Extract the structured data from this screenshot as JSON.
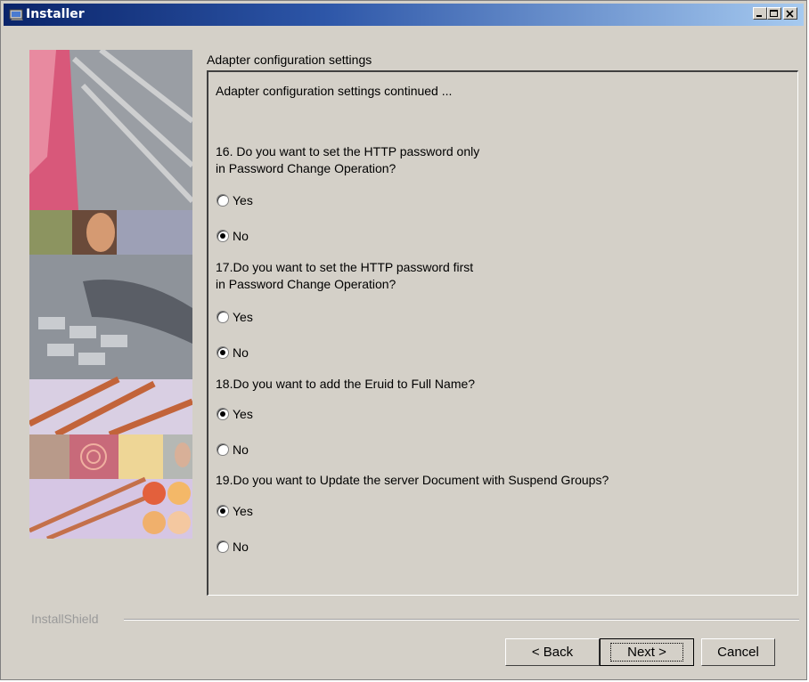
{
  "window": {
    "title": "Installer"
  },
  "panel": {
    "section_label": "Adapter configuration settings",
    "subtitle": "Adapter configuration settings continued ...",
    "questions": [
      {
        "line1": "16. Do you want to set the HTTP password only",
        "line2": "in Password Change Operation?",
        "options": [
          "Yes",
          "No"
        ],
        "selected": "No"
      },
      {
        "line1": "17.Do you want to set the HTTP password first",
        "line2": "in Password Change Operation?",
        "options": [
          "Yes",
          "No"
        ],
        "selected": "No"
      },
      {
        "line1": "18.Do you want to add the Eruid to Full Name?",
        "options": [
          "Yes",
          "No"
        ],
        "selected": "Yes"
      },
      {
        "line1": "19.Do you want to Update the server Document with Suspend Groups?",
        "options": [
          "Yes",
          "No"
        ],
        "selected": "Yes"
      }
    ]
  },
  "footer": {
    "brand": "InstallShield",
    "back_label": "< Back",
    "next_label": "Next >",
    "cancel_label": "Cancel"
  }
}
